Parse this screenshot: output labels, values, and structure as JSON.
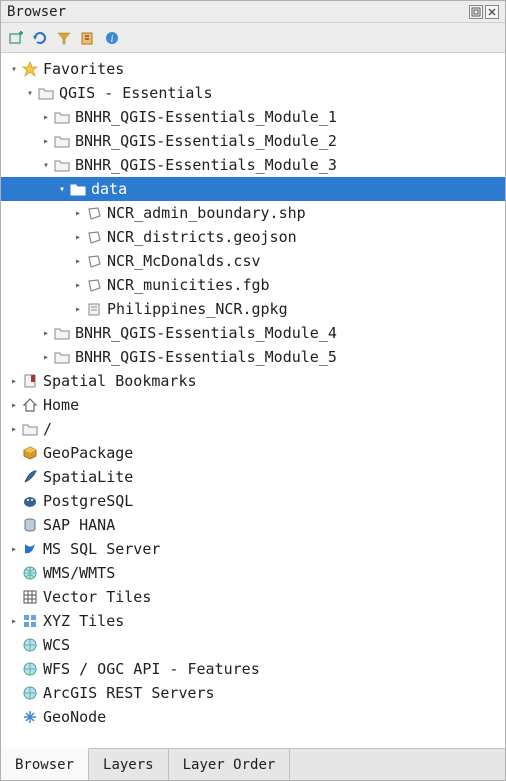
{
  "panel": {
    "title": "Browser"
  },
  "toolbar": {
    "add": "add",
    "refresh": "refresh",
    "filter": "filter",
    "collapse": "collapse",
    "properties": "properties"
  },
  "tree": {
    "favorites": {
      "label": "Favorites",
      "qgis_essentials": {
        "label": "QGIS - Essentials",
        "module1": "BNHR_QGIS-Essentials_Module_1",
        "module2": "BNHR_QGIS-Essentials_Module_2",
        "module3": {
          "label": "BNHR_QGIS-Essentials_Module_3",
          "data": {
            "label": "data",
            "files": {
              "f0": "NCR_admin_boundary.shp",
              "f1": "NCR_districts.geojson",
              "f2": "NCR_McDonalds.csv",
              "f3": "NCR_municities.fgb",
              "f4": "Philippines_NCR.gpkg"
            }
          }
        },
        "module4": "BNHR_QGIS-Essentials_Module_4",
        "module5": "BNHR_QGIS-Essentials_Module_5"
      }
    },
    "spatial_bookmarks": "Spatial Bookmarks",
    "home": "Home",
    "root": "/",
    "geopackage": "GeoPackage",
    "spatialite": "SpatiaLite",
    "postgresql": "PostgreSQL",
    "sap_hana": "SAP HANA",
    "mssql": "MS SQL Server",
    "wms": "WMS/WMTS",
    "vector_tiles": "Vector Tiles",
    "xyz": "XYZ Tiles",
    "wcs": "WCS",
    "wfs": "WFS / OGC API - Features",
    "arcgis": "ArcGIS REST Servers",
    "geonode": "GeoNode"
  },
  "tabs": {
    "browser": "Browser",
    "layers": "Layers",
    "layer_order": "Layer Order"
  }
}
